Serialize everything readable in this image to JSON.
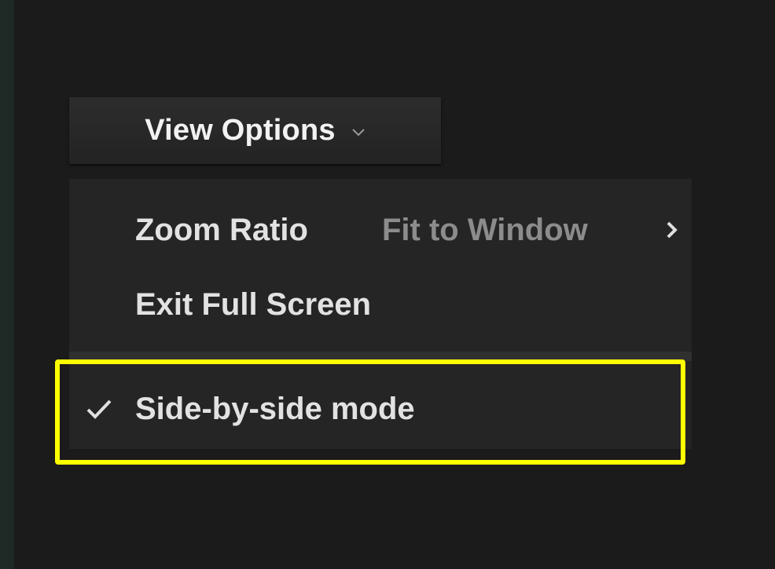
{
  "view_options": {
    "label": "View Options",
    "chevron_icon": "chevron-down-icon"
  },
  "menu": {
    "items": [
      {
        "label": "Zoom Ratio",
        "value": "Fit to Window",
        "icon": "chevron-right-icon"
      },
      {
        "label": "Exit Full Screen"
      },
      {
        "label": "Side-by-side mode",
        "checked": true,
        "icon": "check-icon"
      }
    ]
  },
  "highlight": {
    "color": "#ffff00"
  }
}
